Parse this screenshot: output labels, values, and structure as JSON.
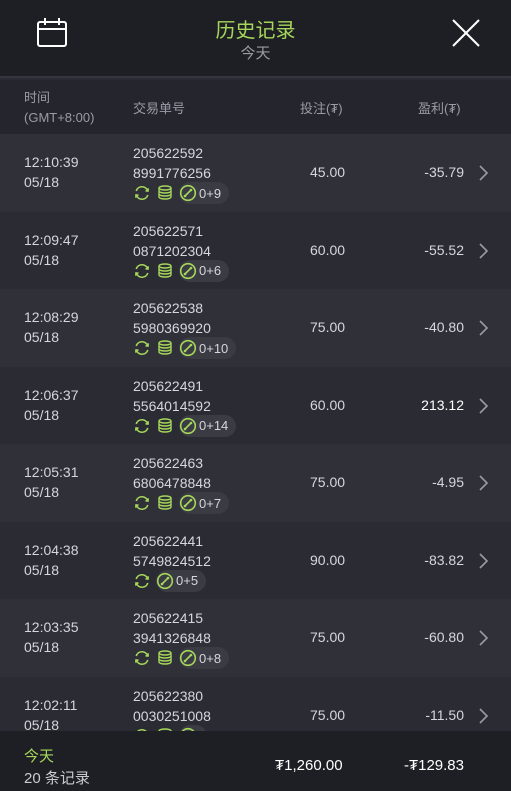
{
  "header": {
    "title": "历史记录",
    "subtitle": "今天",
    "calendar_icon": "calendar-icon",
    "close_icon": "close-icon"
  },
  "columns": {
    "time": "时间",
    "timezone": "(GMT+8:00)",
    "order": "交易单号",
    "stake": "投注(₮)",
    "profit": "盈利(₮)"
  },
  "rows": [
    {
      "time": "12:10:39",
      "date": "05/18",
      "order_a": "205622592",
      "order_b": "8991776256",
      "icons": [
        "refresh-icon",
        "coins-icon"
      ],
      "pill": "0+9",
      "stake": "45.00",
      "profit": "-35.79"
    },
    {
      "time": "12:09:47",
      "date": "05/18",
      "order_a": "205622571",
      "order_b": "0871202304",
      "icons": [
        "refresh-icon",
        "coins-icon"
      ],
      "pill": "0+6",
      "stake": "60.00",
      "profit": "-55.52"
    },
    {
      "time": "12:08:29",
      "date": "05/18",
      "order_a": "205622538",
      "order_b": "5980369920",
      "icons": [
        "refresh-icon",
        "coins-icon"
      ],
      "pill": "0+10",
      "stake": "75.00",
      "profit": "-40.80"
    },
    {
      "time": "12:06:37",
      "date": "05/18",
      "order_a": "205622491",
      "order_b": "5564014592",
      "icons": [
        "refresh-icon",
        "coins-icon"
      ],
      "pill": "0+14",
      "stake": "60.00",
      "profit": "213.12"
    },
    {
      "time": "12:05:31",
      "date": "05/18",
      "order_a": "205622463",
      "order_b": "6806478848",
      "icons": [
        "refresh-icon",
        "coins-icon"
      ],
      "pill": "0+7",
      "stake": "75.00",
      "profit": "-4.95"
    },
    {
      "time": "12:04:38",
      "date": "05/18",
      "order_a": "205622441",
      "order_b": "5749824512",
      "icons": [
        "refresh-icon"
      ],
      "pill": "0+5",
      "stake": "90.00",
      "profit": "-83.82"
    },
    {
      "time": "12:03:35",
      "date": "05/18",
      "order_a": "205622415",
      "order_b": "3941326848",
      "icons": [
        "refresh-icon",
        "coins-icon"
      ],
      "pill": "0+8",
      "stake": "75.00",
      "profit": "-60.80"
    },
    {
      "time": "12:02:11",
      "date": "05/18",
      "order_a": "205622380",
      "order_b": "0030251008",
      "icons": [
        "refresh-icon",
        "coins-icon"
      ],
      "pill": "",
      "stake": "75.00",
      "profit": "-11.50"
    }
  ],
  "footer": {
    "today": "今天",
    "count": "20 条记录",
    "total_stake": "₮1,260.00",
    "total_profit": "-₮129.83"
  },
  "colors": {
    "accent": "#a6d75a",
    "background": "#2a2b33",
    "row_alt": "#2f3038",
    "header_bg": "#1e1f25"
  }
}
